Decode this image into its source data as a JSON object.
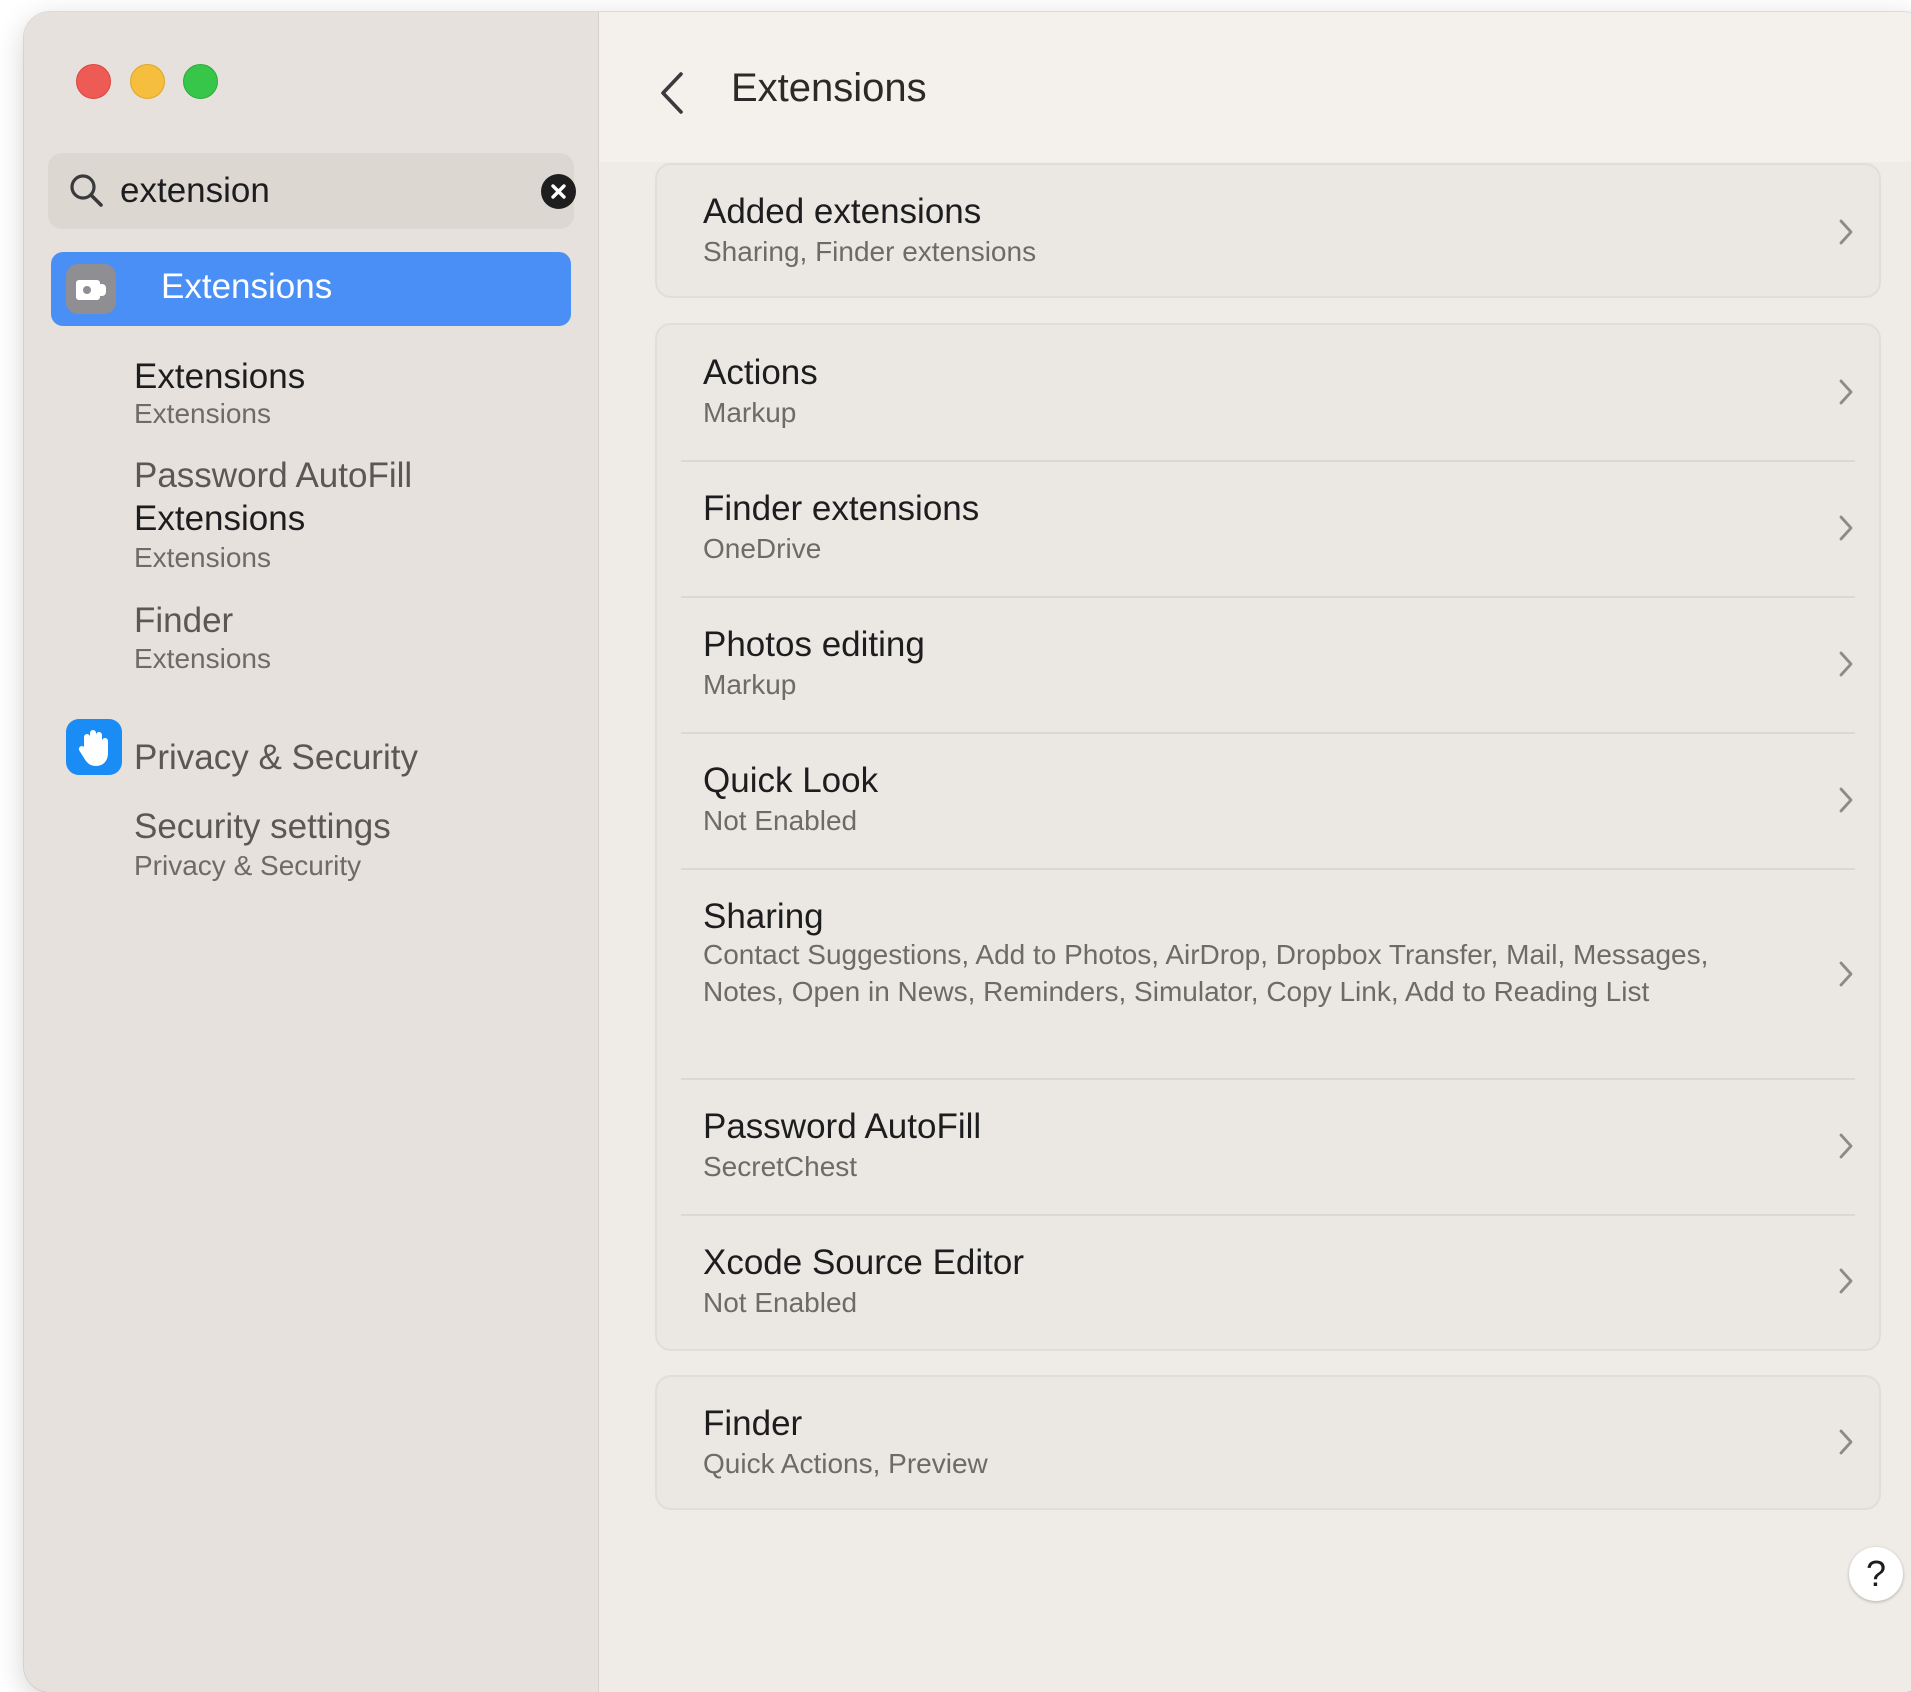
{
  "search": {
    "value": "extension",
    "clear_icon": "xmark-circle-fill-icon"
  },
  "sidebar": {
    "selected": {
      "label": "Extensions",
      "icon": "extensions-puzzle-icon"
    },
    "results": [
      {
        "title": "Extensions",
        "subtitle": "Extensions"
      },
      {
        "title_line1": "Password AutoFill",
        "title_line2": "Extensions",
        "subtitle": "Extensions"
      },
      {
        "title": "Finder",
        "subtitle": "Extensions"
      }
    ],
    "privacy": {
      "label": "Privacy & Security",
      "icon": "hand-raised-icon",
      "result_title": "Security settings",
      "result_subtitle": "Privacy & Security"
    }
  },
  "main": {
    "title": "Extensions",
    "back_icon": "chevron-left-icon",
    "cards": [
      {
        "rows": [
          {
            "title": "Added extensions",
            "subtitle": "Sharing, Finder extensions"
          }
        ]
      },
      {
        "rows": [
          {
            "title": "Actions",
            "subtitle": "Markup"
          },
          {
            "title": "Finder extensions",
            "subtitle": "OneDrive"
          },
          {
            "title": "Photos editing",
            "subtitle": "Markup"
          },
          {
            "title": "Quick Look",
            "subtitle": "Not Enabled"
          },
          {
            "title": "Sharing",
            "subtitle": "Contact Suggestions, Add to Photos, AirDrop, Dropbox Transfer, Mail, Messages, Notes, Open in News, Reminders, Simulator, Copy Link, Add to Reading List"
          },
          {
            "title": "Password AutoFill",
            "subtitle": "SecretChest"
          },
          {
            "title": "Xcode Source Editor",
            "subtitle": "Not Enabled"
          }
        ]
      },
      {
        "rows": [
          {
            "title": "Finder",
            "subtitle": "Quick Actions, Preview"
          }
        ]
      }
    ],
    "help_label": "?"
  },
  "colors": {
    "accent": "#4a8ff5",
    "privacy_icon": "#1a8cf6",
    "traffic_red": "#ee5b55",
    "traffic_yellow": "#f5be3c",
    "traffic_green": "#37c64a"
  }
}
